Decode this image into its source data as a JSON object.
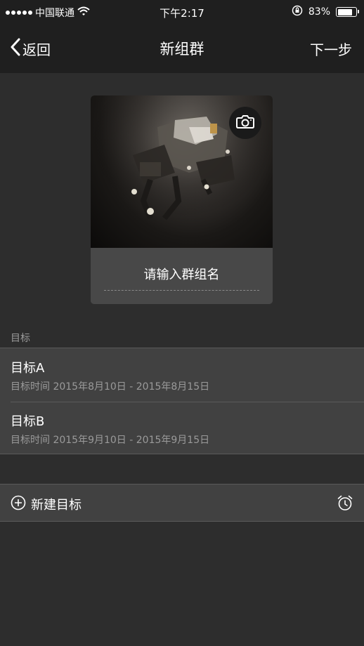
{
  "status_bar": {
    "carrier": "中国联通",
    "time": "下午2:17",
    "battery_text": "83%",
    "battery_level": 0.83,
    "icons": [
      "signal-dots-icon",
      "wifi-icon",
      "rotation-lock-icon",
      "battery-icon"
    ]
  },
  "nav": {
    "back_label": "返回",
    "title": "新组群",
    "next_label": "下一步"
  },
  "group_card": {
    "image_description_icon": "camera-icon",
    "name_placeholder": "请输入群组名"
  },
  "goals_section": {
    "header": "目标",
    "items": [
      {
        "title": "目标A",
        "time": "目标时间 2015年8月10日 - 2015年8月15日"
      },
      {
        "title": "目标B",
        "time": "目标时间 2015年9月10日 - 2015年9月15日"
      }
    ]
  },
  "new_goal": {
    "label": "新建目标",
    "icons": [
      "plus-circle-icon",
      "alarm-clock-icon"
    ]
  },
  "colors": {
    "background": "#2d2d2d",
    "bar_background": "#1f1f1f",
    "cell_background": "#414141",
    "secondary_text": "#9a9a9a"
  }
}
